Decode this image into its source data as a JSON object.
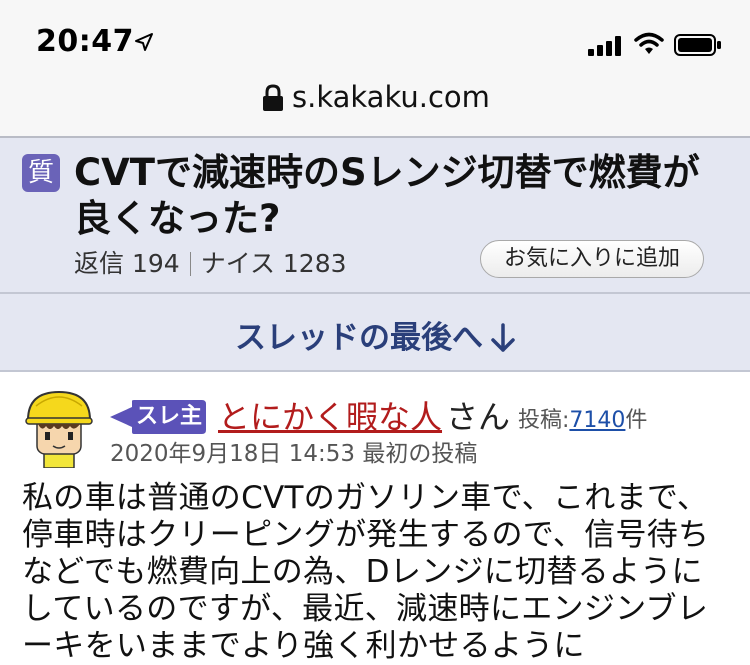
{
  "status_bar": {
    "time": "20:47"
  },
  "browser": {
    "url": "s.kakaku.com"
  },
  "thread": {
    "badge": "質",
    "title": "CVTで減速時のSレンジ切替で燃費が良くなった?",
    "replies_label": "返信",
    "replies_count": "194",
    "nice_label": "ナイス",
    "nice_count": "1283",
    "favorite_button": "お気に入りに追加"
  },
  "jump": {
    "label": "スレッドの最後へ"
  },
  "post": {
    "owner_badge": "スレ主",
    "author_name": "とにかく暇な人",
    "author_suffix": "さん",
    "post_count_label": "投稿:",
    "post_count_value": "7140",
    "post_count_unit": "件",
    "date": "2020年9月18日 14:53 最初の投稿",
    "body": "私の車は普通のCVTのガソリン車で、これまで、停車時はクリーピングが発生するので、信号待ちなどでも燃費向上の為、Dレンジに切替るようにしているのですが、最近、減速時にエンジンブレーキをいままでより強く利かせるように"
  },
  "colors": {
    "header_bg": "#e4e7f2",
    "badge_purple": "#6a63b8",
    "link_blue": "#2a3f7a",
    "author_red": "#b21c1c"
  }
}
